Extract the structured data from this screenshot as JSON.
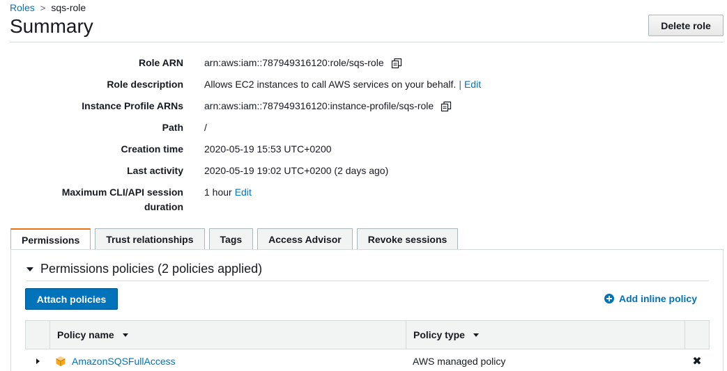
{
  "breadcrumb": {
    "parent": "Roles",
    "separator": ">",
    "current": "sqs-role"
  },
  "page_title": "Summary",
  "delete_button": "Delete role",
  "summary": {
    "role_arn": {
      "label": "Role ARN",
      "value": "arn:aws:iam::787949316120:role/sqs-role"
    },
    "role_description": {
      "label": "Role description",
      "value": "Allows EC2 instances to call AWS services on your behalf.",
      "separator": "|",
      "edit": "Edit"
    },
    "instance_profile_arns": {
      "label": "Instance Profile ARNs",
      "value": "arn:aws:iam::787949316120:instance-profile/sqs-role"
    },
    "path": {
      "label": "Path",
      "value": "/"
    },
    "creation_time": {
      "label": "Creation time",
      "value": "2020-05-19 15:53 UTC+0200"
    },
    "last_activity": {
      "label": "Last activity",
      "value": "2020-05-19 19:02 UTC+0200 (2 days ago)"
    },
    "max_session": {
      "label_line1": "Maximum CLI/API session",
      "label_line2": "duration",
      "value": "1 hour",
      "edit": "Edit"
    }
  },
  "tabs": [
    "Permissions",
    "Trust relationships",
    "Tags",
    "Access Advisor",
    "Revoke sessions"
  ],
  "active_tab": "Permissions",
  "permissions": {
    "section_title": "Permissions policies (2 policies applied)",
    "attach_button": "Attach policies",
    "add_inline": "Add inline policy",
    "columns": {
      "policy_name": "Policy name",
      "policy_type": "Policy type"
    },
    "rows": [
      {
        "name": "AmazonSQSFullAccess",
        "type": "AWS managed policy",
        "remove": "✖"
      }
    ]
  },
  "colors": {
    "link": "#0073bb",
    "primary_button": "#0073bb",
    "active_tab_border": "#ec7211",
    "policy_icon": "#f7a81b"
  }
}
